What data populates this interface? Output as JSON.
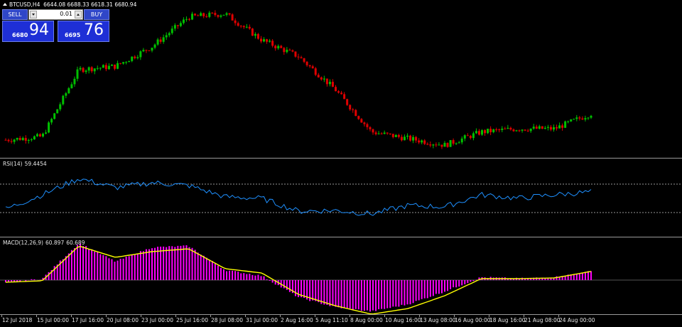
{
  "symbol": {
    "title": "BTCUSD,H4",
    "ohlc": "6644.08 6688.33 6618.31 6680.94"
  },
  "trade_panel": {
    "sell_label": "SELL",
    "buy_label": "BUY",
    "lot": "0.01",
    "sell_price_small": "6680",
    "sell_price_big": "94",
    "buy_price_small": "6695",
    "buy_price_big": "76"
  },
  "colors": {
    "background": "#000000",
    "bull_candle": "#00c000",
    "bear_candle": "#e00000",
    "rsi_line": "#1e90ff",
    "macd_histogram": "#ff00ff",
    "macd_signal": "#ffff00",
    "panel_blue": "#1e2fd6"
  },
  "rsi": {
    "label": "RSI(14)",
    "value": "59.4454",
    "levels": [
      70,
      30
    ]
  },
  "macd": {
    "label": "MACD(12,26,9)",
    "main": "60.897",
    "signal": "60.689"
  },
  "x_axis_labels": [
    "12 Jul 2018",
    "15 Jul 00:00",
    "17 Jul 16:00",
    "20 Jul 08:00",
    "23 Jul 00:00",
    "25 Jul 16:00",
    "28 Jul 08:00",
    "31 Jul 00:00",
    "2 Aug 16:00",
    "5 Aug 11:10",
    "8 Aug 00:00",
    "10 Aug 16:00",
    "13 Aug 08:00",
    "16 Aug 00:00",
    "18 Aug 16:00",
    "21 Aug 08:00",
    "24 Aug 00:00"
  ],
  "chart_data": [
    {
      "type": "candlestick",
      "name": "BTCUSD H4 price",
      "points_approx": [
        {
          "x": "12 Jul 2018",
          "close": 6280
        },
        {
          "x": "15 Jul 00:00",
          "close": 6330
        },
        {
          "x": "17 Jul 16:00",
          "close": 7350
        },
        {
          "x": "20 Jul 08:00",
          "close": 7400
        },
        {
          "x": "23 Jul 00:00",
          "close": 7700
        },
        {
          "x": "25 Jul 16:00",
          "close": 8150
        },
        {
          "x": "28 Jul 08:00",
          "close": 8200
        },
        {
          "x": "31 Jul 00:00",
          "close": 7800
        },
        {
          "x": "2 Aug 16:00",
          "close": 7550
        },
        {
          "x": "5 Aug 11:10",
          "close": 7050
        },
        {
          "x": "8 Aug 00:00",
          "close": 6400
        },
        {
          "x": "10 Aug 16:00",
          "close": 6300
        },
        {
          "x": "13 Aug 08:00",
          "close": 6200
        },
        {
          "x": "16 Aug 00:00",
          "close": 6400
        },
        {
          "x": "18 Aug 16:00",
          "close": 6450
        },
        {
          "x": "21 Aug 08:00",
          "close": 6450
        },
        {
          "x": "24 Aug 00:00",
          "close": 6680
        }
      ]
    },
    {
      "type": "line",
      "name": "RSI(14)",
      "levels": [
        70,
        30
      ],
      "points_approx": [
        {
          "x": "12 Jul 2018",
          "y": 35
        },
        {
          "x": "15 Jul 00:00",
          "y": 55
        },
        {
          "x": "17 Jul 16:00",
          "y": 78
        },
        {
          "x": "20 Jul 08:00",
          "y": 65
        },
        {
          "x": "23 Jul 00:00",
          "y": 72
        },
        {
          "x": "25 Jul 16:00",
          "y": 68
        },
        {
          "x": "28 Jul 08:00",
          "y": 52
        },
        {
          "x": "31 Jul 00:00",
          "y": 50
        },
        {
          "x": "2 Aug 16:00",
          "y": 32
        },
        {
          "x": "5 Aug 11:10",
          "y": 33
        },
        {
          "x": "8 Aug 00:00",
          "y": 28
        },
        {
          "x": "10 Aug 16:00",
          "y": 40
        },
        {
          "x": "13 Aug 08:00",
          "y": 38
        },
        {
          "x": "16 Aug 00:00",
          "y": 55
        },
        {
          "x": "18 Aug 16:00",
          "y": 50
        },
        {
          "x": "21 Aug 08:00",
          "y": 55
        },
        {
          "x": "24 Aug 00:00",
          "y": 59
        }
      ]
    },
    {
      "type": "bar+line",
      "name": "MACD(12,26,9)",
      "points_approx": [
        {
          "x": "12 Jul 2018",
          "macd": -20,
          "signal": -15
        },
        {
          "x": "15 Jul 00:00",
          "macd": 10,
          "signal": -5
        },
        {
          "x": "17 Jul 16:00",
          "macd": 260,
          "signal": 240
        },
        {
          "x": "20 Jul 08:00",
          "macd": 130,
          "signal": 160
        },
        {
          "x": "23 Jul 00:00",
          "macd": 230,
          "signal": 200
        },
        {
          "x": "25 Jul 16:00",
          "macd": 240,
          "signal": 220
        },
        {
          "x": "28 Jul 08:00",
          "macd": 70,
          "signal": 80
        },
        {
          "x": "31 Jul 00:00",
          "macd": 30,
          "signal": 50
        },
        {
          "x": "2 Aug 16:00",
          "macd": -120,
          "signal": -100
        },
        {
          "x": "5 Aug 11:10",
          "macd": -190,
          "signal": -180
        },
        {
          "x": "8 Aug 00:00",
          "macd": -220,
          "signal": -240
        },
        {
          "x": "10 Aug 16:00",
          "macd": -170,
          "signal": -200
        },
        {
          "x": "13 Aug 08:00",
          "macd": -80,
          "signal": -110
        },
        {
          "x": "16 Aug 00:00",
          "macd": 20,
          "signal": 10
        },
        {
          "x": "18 Aug 16:00",
          "macd": 10,
          "signal": 10
        },
        {
          "x": "21 Aug 08:00",
          "macd": 20,
          "signal": 15
        },
        {
          "x": "24 Aug 00:00",
          "macd": 61,
          "signal": 61
        }
      ]
    }
  ]
}
